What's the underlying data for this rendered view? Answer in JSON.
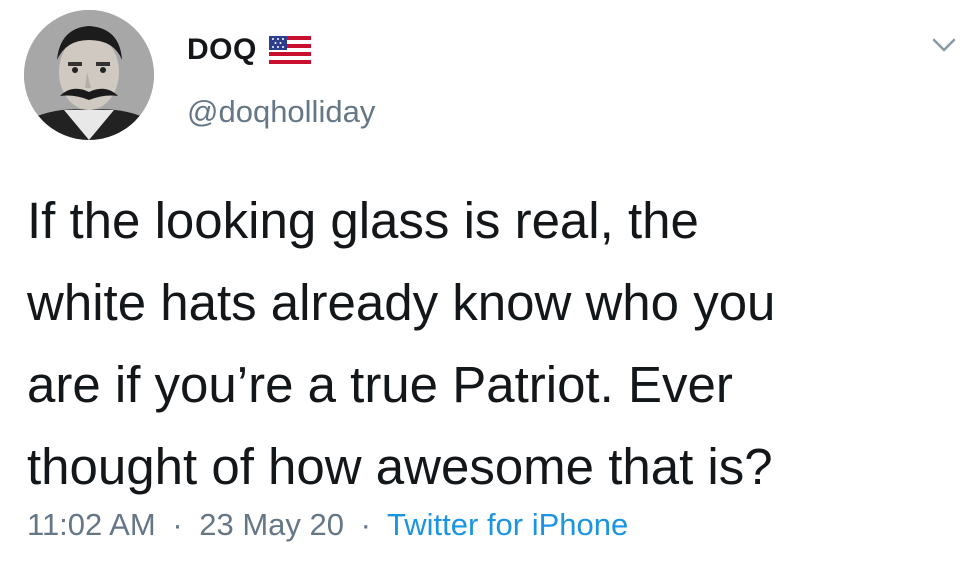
{
  "user": {
    "display_name": "DOQ",
    "handle": "@doqholliday",
    "flag_icon": "us-flag-icon",
    "avatar_icon": "mustached-man-portrait"
  },
  "tweet": {
    "text_lines": [
      "If the looking glass is real, the",
      "white hats already know who you",
      "are if you’re a true Patriot. Ever",
      "thought of how awesome that is?"
    ]
  },
  "meta": {
    "time": "11:02 AM",
    "date": "23 May 20",
    "separator": "·",
    "source": "Twitter for iPhone"
  },
  "menu": {
    "caret_icon": "chevron-down-icon"
  },
  "colors": {
    "text": "#14171a",
    "secondary": "#657786",
    "link": "#1b95e0",
    "background": "#ffffff"
  }
}
